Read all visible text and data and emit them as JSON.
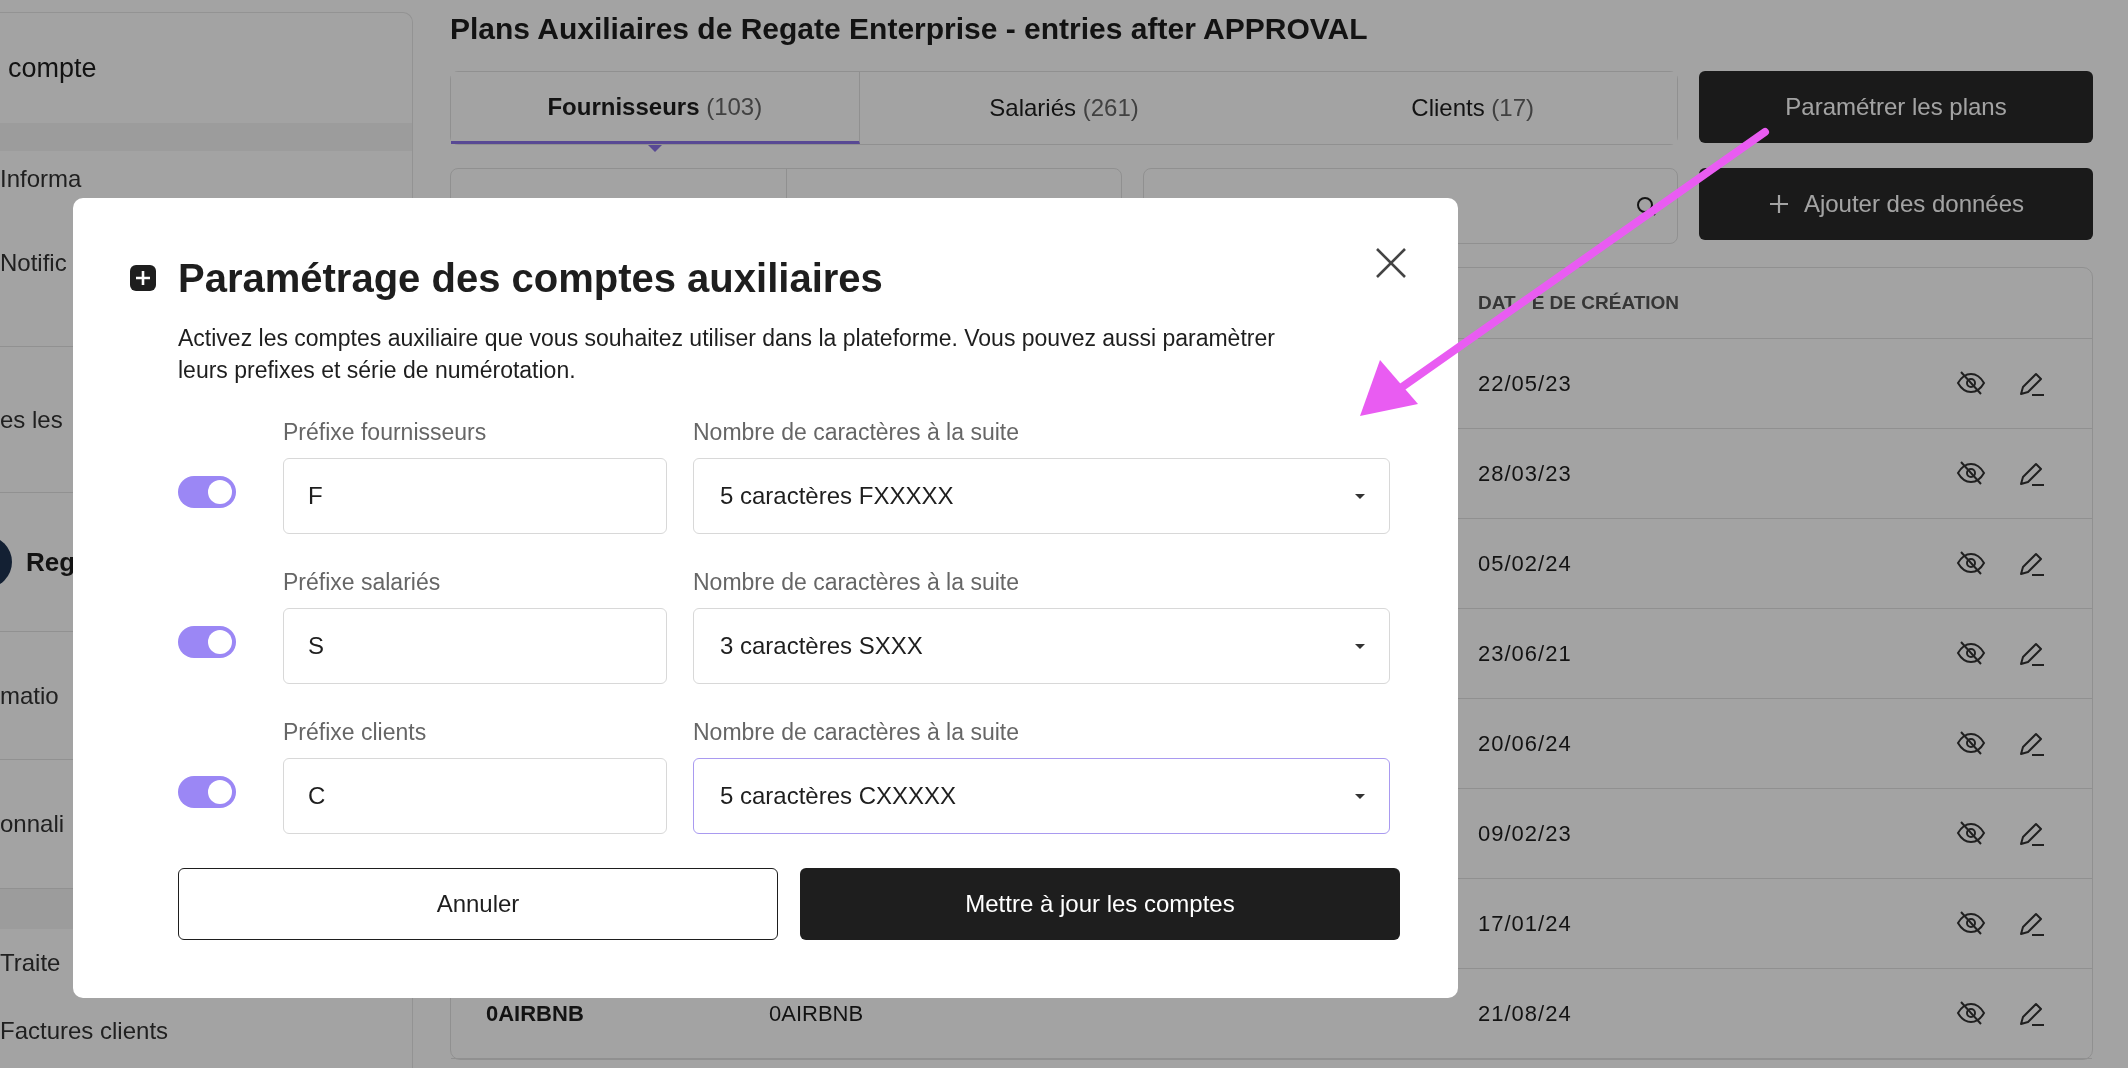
{
  "sidebar": {
    "heading": "compte",
    "sections": [
      {
        "items": [
          {
            "kind": "link",
            "label": "Informa"
          },
          {
            "kind": "link",
            "label": "Notific"
          }
        ]
      },
      {
        "items": [
          {
            "kind": "link",
            "label": "es les"
          }
        ]
      },
      {
        "items": [
          {
            "kind": "company",
            "label": "Reg"
          }
        ]
      },
      {
        "items": [
          {
            "kind": "link",
            "label": "matio"
          }
        ]
      },
      {
        "items": [
          {
            "kind": "link",
            "label": "onnali"
          }
        ]
      },
      {
        "items": [
          {
            "kind": "link",
            "label": "Traite"
          },
          {
            "kind": "link",
            "label": "Factures clients"
          }
        ]
      }
    ]
  },
  "page_title": "Plans Auxiliaires de Regate Enterprise - entries after APPROVAL",
  "tabs": [
    {
      "label": "Fournisseurs",
      "count": "(103)",
      "selected": true
    },
    {
      "label": "Salariés",
      "count": "(261)",
      "selected": false
    },
    {
      "label": "Clients",
      "count": "(17)",
      "selected": false
    }
  ],
  "configure_button": "Paramétrer les plans",
  "add_button": "Ajouter des données",
  "table": {
    "date_column": [
      "DAT",
      "E DE CRÉATION"
    ],
    "rows": [
      {
        "date": "22/05/23"
      },
      {
        "date": "28/03/23"
      },
      {
        "date": "05/02/24"
      },
      {
        "date": "23/06/21"
      },
      {
        "date": "20/06/24"
      },
      {
        "date": "09/02/23"
      },
      {
        "date": "17/01/24"
      },
      {
        "code": "0AIRBNB",
        "name": "0AIRBNB",
        "date": "21/08/24"
      }
    ]
  },
  "modal": {
    "title": "Paramétrage des comptes auxiliaires",
    "description": "Activez les comptes auxiliaire que vous souhaitez utiliser dans la plateforme. Vous pouvez aussi paramètrer leurs prefixes et série de numérotation.",
    "rows": [
      {
        "enabled": true,
        "prefix_label": "Préfixe fournisseurs",
        "prefix_value": "F",
        "length_label": "Nombre de caractères à la suite",
        "length_value": "5 caractères FXXXXX",
        "focused": false
      },
      {
        "enabled": true,
        "prefix_label": "Préfixe salariés",
        "prefix_value": "S",
        "length_label": "Nombre de caractères à la suite",
        "length_value": "3 caractères SXXX",
        "focused": false
      },
      {
        "enabled": true,
        "prefix_label": "Préfixe clients",
        "prefix_value": "C",
        "length_label": "Nombre de caractères à la suite",
        "length_value": "5 caractères CXXXXX",
        "focused": true
      }
    ],
    "cancel_button": "Annuler",
    "submit_button": "Mettre à jour les comptes"
  }
}
